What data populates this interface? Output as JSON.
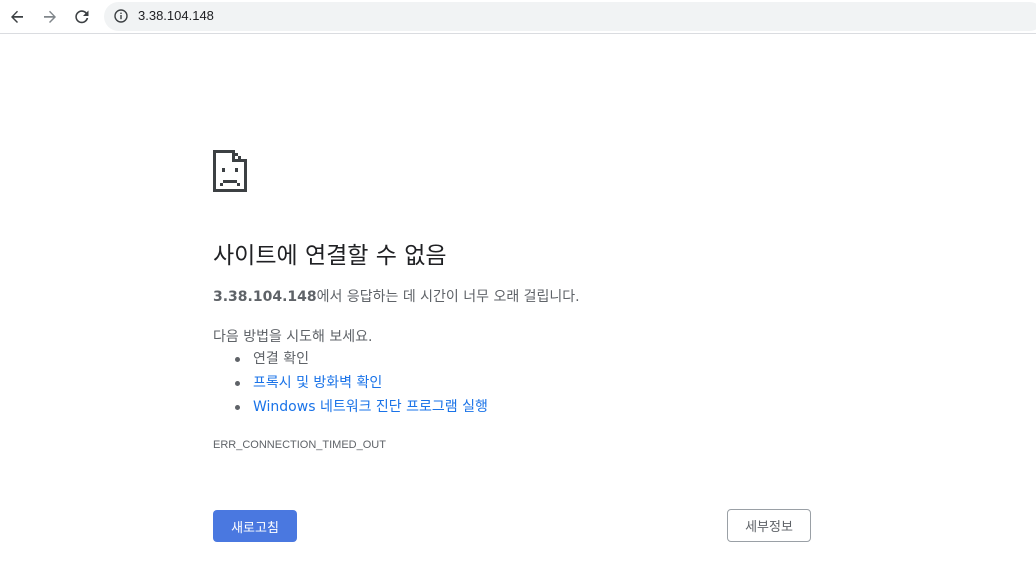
{
  "browser": {
    "url": "3.38.104.148",
    "icons": {
      "back": "back-arrow-icon",
      "forward": "forward-arrow-icon",
      "reload": "reload-icon",
      "info": "info-icon"
    }
  },
  "error_page": {
    "icon": "sad-document-icon",
    "title": "사이트에 연결할 수 없음",
    "summary_host": "3.38.104.148",
    "summary_rest": "에서 응답하는 데 시간이 너무 오래 걸립니다.",
    "suggestions_heading": "다음 방법을 시도해 보세요.",
    "suggestions": [
      {
        "label": "연결 확인"
      },
      {
        "label": "프록시 및 방화벽 확인"
      },
      {
        "label": "Windows 네트워크 진단 프로그램 실행"
      }
    ],
    "error_code": "ERR_CONNECTION_TIMED_OUT",
    "reload_label": "새로고침",
    "details_label": "세부정보"
  },
  "colors": {
    "link": "#1a73e8",
    "primary_button": "#4a78e0",
    "text_secondary": "#5f6368"
  }
}
